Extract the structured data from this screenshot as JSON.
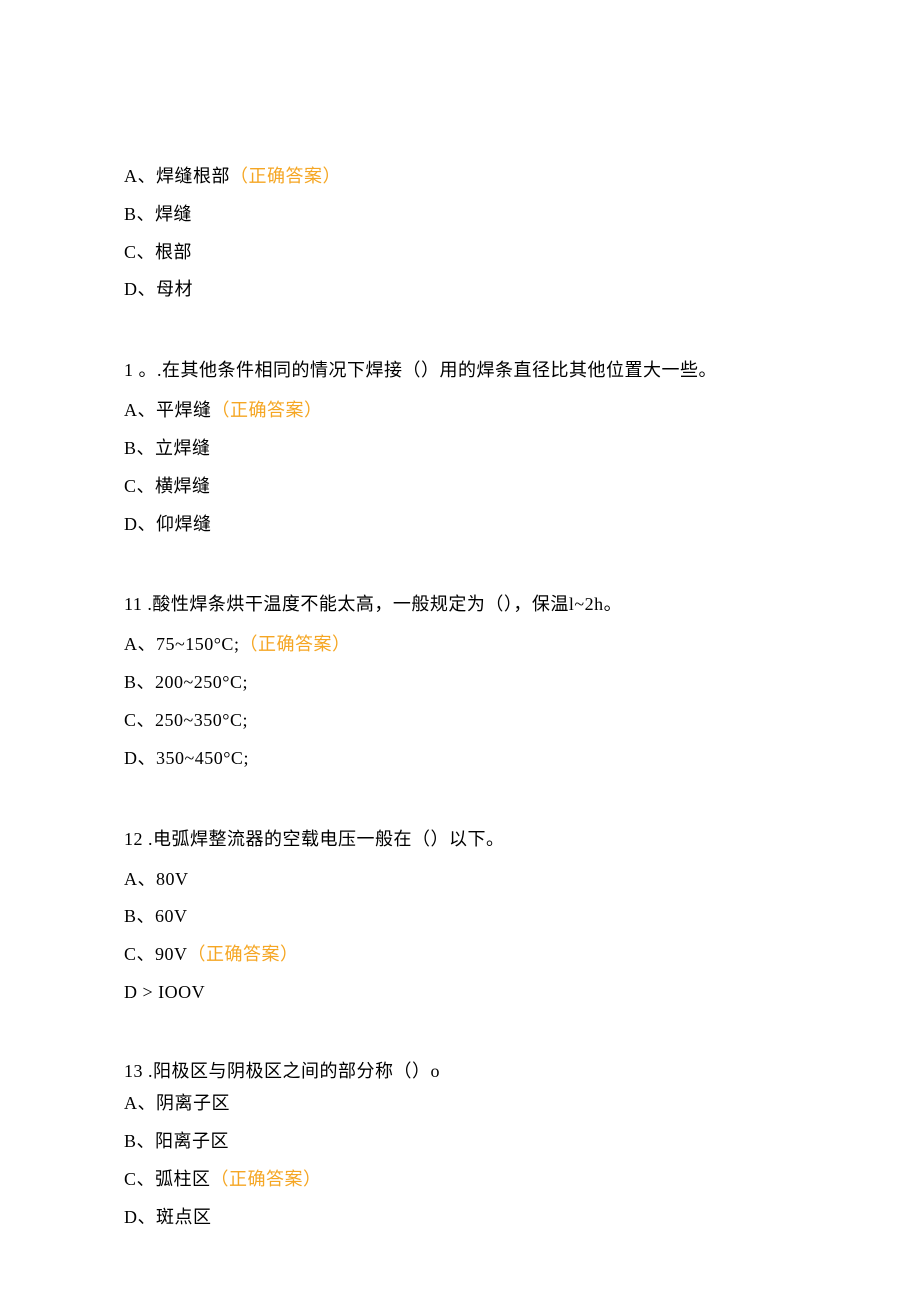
{
  "colors": {
    "correctAnswer": "#f5a623",
    "text": "#000000",
    "background": "#ffffff"
  },
  "correctAnswerLabel": "（正确答案）",
  "questions": [
    {
      "number": "",
      "text": "",
      "options": [
        {
          "label": "A、焊缝根部",
          "correct": true,
          "suffix": "（正确答案）"
        },
        {
          "label": "B、焊缝",
          "correct": false,
          "suffix": ""
        },
        {
          "label": "C、根部",
          "correct": false,
          "suffix": ""
        },
        {
          "label": "D、母材",
          "correct": false,
          "suffix": ""
        }
      ]
    },
    {
      "number": "1",
      "text": "  。.在其他条件相同的情况下焊接（）用的焊条直径比其他位置大一些。",
      "options": [
        {
          "label": "A、平焊缝",
          "correct": true,
          "suffix": "（正确答案）"
        },
        {
          "label": "B、立焊缝",
          "correct": false,
          "suffix": ""
        },
        {
          "label": "C、横焊缝",
          "correct": false,
          "suffix": ""
        },
        {
          "label": "D、仰焊缝",
          "correct": false,
          "suffix": ""
        }
      ]
    },
    {
      "number": "11",
      "text": " .酸性焊条烘干温度不能太高，一般规定为（），保温l~2h。",
      "options": [
        {
          "label": "A、75~150°C;",
          "correct": true,
          "suffix": "（正确答案）"
        },
        {
          "label": "B、200~250°C;",
          "correct": false,
          "suffix": ""
        },
        {
          "label": "C、250~350°C;",
          "correct": false,
          "suffix": ""
        },
        {
          "label": "D、350~450°C;",
          "correct": false,
          "suffix": ""
        }
      ]
    },
    {
      "number": "12",
      "text": " .电弧焊整流器的空载电压一般在（）以下。",
      "options": [
        {
          "label": "A、80V",
          "correct": false,
          "suffix": ""
        },
        {
          "label": "B、60V",
          "correct": false,
          "suffix": ""
        },
        {
          "label": "C、90V",
          "correct": true,
          "suffix": "（正确答案）"
        },
        {
          "label": "D > IOOV",
          "correct": false,
          "suffix": ""
        }
      ]
    },
    {
      "number": "13",
      "text": " .阳极区与阴极区之间的部分称（）o",
      "tight": true,
      "options": [
        {
          "label": "A、阴离子区",
          "correct": false,
          "suffix": ""
        },
        {
          "label": "B、阳离子区",
          "correct": false,
          "suffix": ""
        },
        {
          "label": "C、弧柱区",
          "correct": true,
          "suffix": "（正确答案）"
        },
        {
          "label": "D、斑点区",
          "correct": false,
          "suffix": ""
        }
      ]
    }
  ]
}
